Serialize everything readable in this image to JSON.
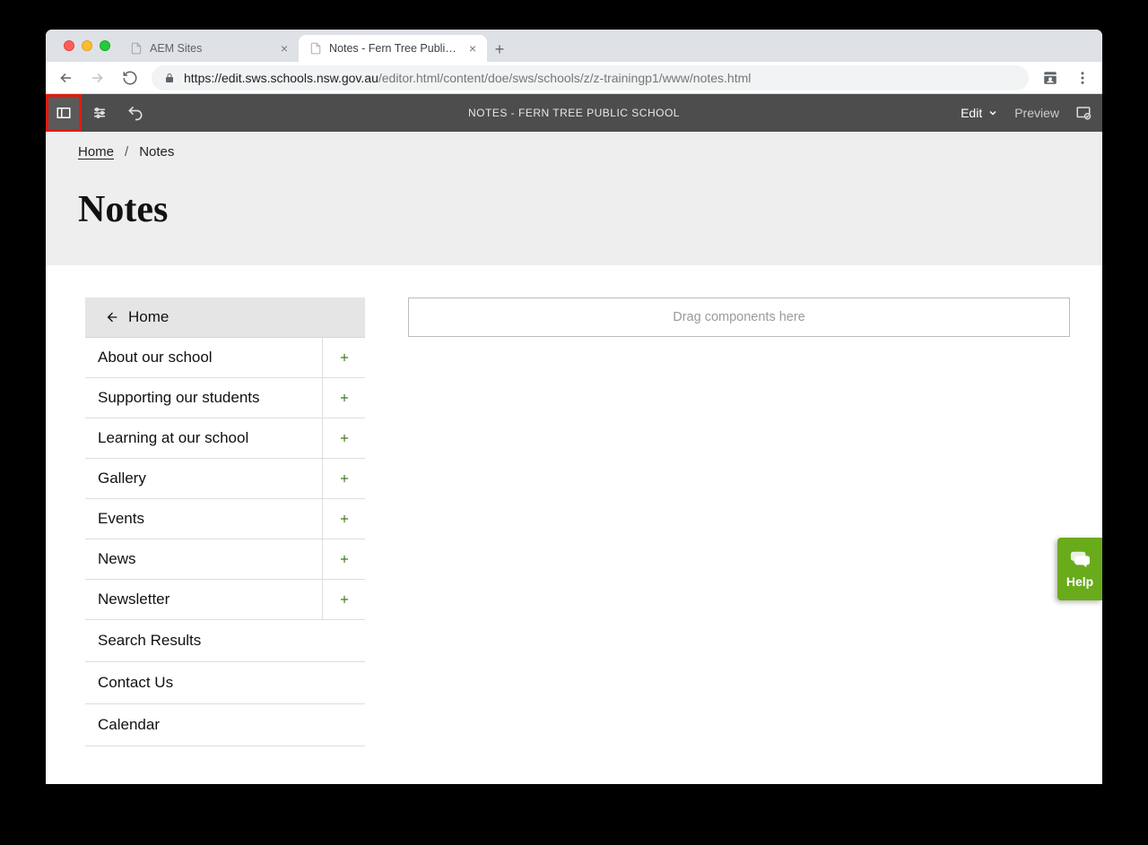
{
  "browser": {
    "tabs": [
      {
        "label": "AEM Sites",
        "active": false
      },
      {
        "label": "Notes - Fern Tree Public Schoo",
        "active": true
      }
    ],
    "url_host": "https://edit.sws.schools.nsw.gov.au",
    "url_path": "/editor.html/content/doe/sws/schools/z/z-trainingp1/www/notes.html"
  },
  "editor": {
    "title": "NOTES - FERN TREE PUBLIC SCHOOL",
    "mode_label": "Edit",
    "preview_label": "Preview"
  },
  "breadcrumb": {
    "home": "Home",
    "current": "Notes"
  },
  "page": {
    "title": "Notes",
    "dropzone_text": "Drag components here"
  },
  "side_nav": {
    "home_label": "Home",
    "items": [
      {
        "label": "About our school",
        "expandable": true
      },
      {
        "label": "Supporting our students",
        "expandable": true
      },
      {
        "label": "Learning at our school",
        "expandable": true
      },
      {
        "label": "Gallery",
        "expandable": true
      },
      {
        "label": "Events",
        "expandable": true
      },
      {
        "label": "News",
        "expandable": true
      },
      {
        "label": "Newsletter",
        "expandable": true
      },
      {
        "label": "Search Results",
        "expandable": false
      },
      {
        "label": "Contact Us",
        "expandable": false
      },
      {
        "label": "Calendar",
        "expandable": false
      }
    ]
  },
  "help": {
    "label": "Help"
  }
}
